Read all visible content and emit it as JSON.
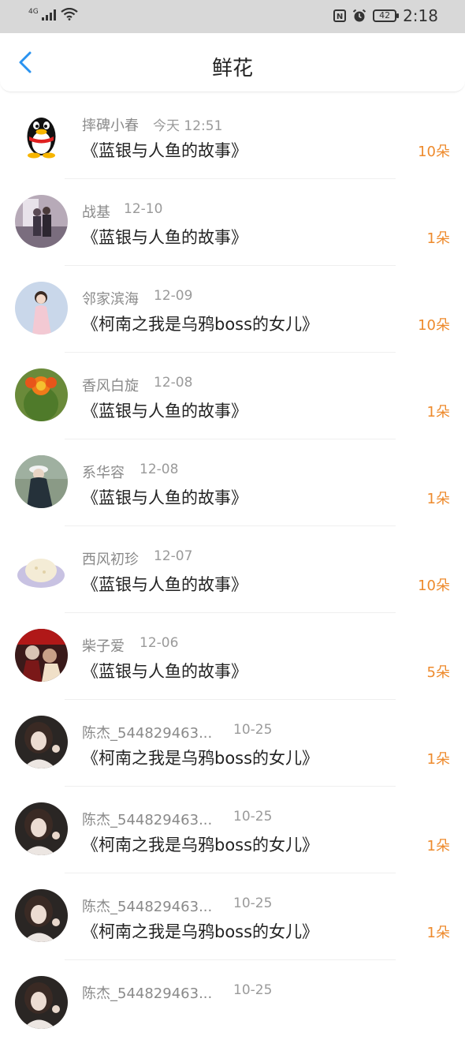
{
  "status_bar": {
    "network": "4G",
    "battery": "42",
    "time": "2:18",
    "nfc": "N"
  },
  "header": {
    "title": "鲜花"
  },
  "colors": {
    "accent": "#2a93f0",
    "count": "#ee8a2c"
  },
  "items": [
    {
      "name": "摔碑小春",
      "date": "今天 12:51",
      "book": "《蓝银与人鱼的故事》",
      "count": "10朵",
      "avatar": "qq-penguin"
    },
    {
      "name": "战基",
      "date": "12-10",
      "book": "《蓝银与人鱼的故事》",
      "count": "1朵",
      "avatar": "photo-couple"
    },
    {
      "name": "邻家滨海",
      "date": "12-09",
      "book": "《柯南之我是乌鸦boss的女儿》",
      "count": "10朵",
      "avatar": "photo-girl-pink"
    },
    {
      "name": "香风白旋",
      "date": "12-08",
      "book": "《蓝银与人鱼的故事》",
      "count": "1朵",
      "avatar": "photo-cactus-flower"
    },
    {
      "name": "系华容",
      "date": "12-08",
      "book": "《蓝银与人鱼的故事》",
      "count": "1朵",
      "avatar": "photo-girl-hat"
    },
    {
      "name": "西风初珍",
      "date": "12-07",
      "book": "《蓝银与人鱼的故事》",
      "count": "10朵",
      "avatar": "photo-bun"
    },
    {
      "name": "柴子爱",
      "date": "12-06",
      "book": "《蓝银与人鱼的故事》",
      "count": "5朵",
      "avatar": "photo-anime"
    },
    {
      "name": "陈杰_544829463...",
      "date": "10-25",
      "book": "《柯南之我是乌鸦boss的女儿》",
      "count": "1朵",
      "avatar": "photo-girl-dark"
    },
    {
      "name": "陈杰_544829463...",
      "date": "10-25",
      "book": "《柯南之我是乌鸦boss的女儿》",
      "count": "1朵",
      "avatar": "photo-girl-dark"
    },
    {
      "name": "陈杰_544829463...",
      "date": "10-25",
      "book": "《柯南之我是乌鸦boss的女儿》",
      "count": "1朵",
      "avatar": "photo-girl-dark"
    },
    {
      "name": "陈杰_544829463...",
      "date": "10-25",
      "book": "",
      "count": "",
      "avatar": "photo-girl-dark"
    }
  ]
}
